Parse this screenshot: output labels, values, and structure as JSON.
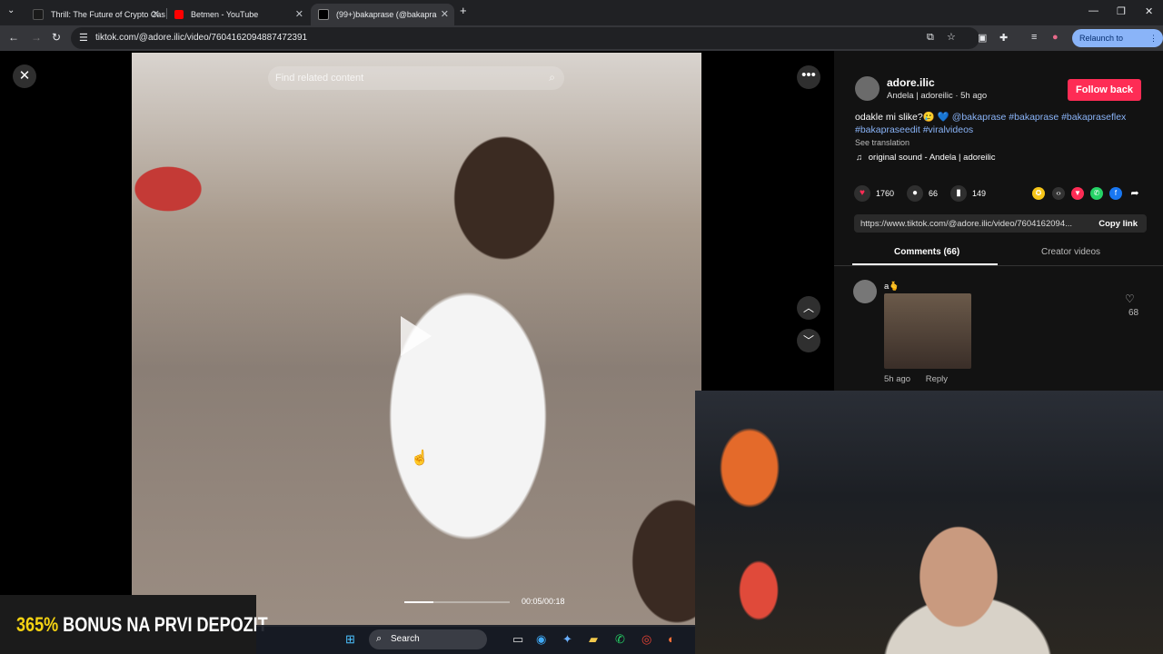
{
  "browser": {
    "tabs": [
      {
        "title": "Thrill: The Future of Crypto Casi",
        "favicon_color": "#1a1a1a"
      },
      {
        "title": "Betmen - YouTube",
        "favicon_color": "#ff0000"
      },
      {
        "title": "(99+)bakaprase (@bakapra",
        "favicon_color": "#000000"
      }
    ],
    "new_tab": "+",
    "url": "tiktok.com/@adore.ilic/video/7604162094887472391",
    "relaunch_label": "Relaunch to update"
  },
  "video": {
    "search_placeholder": "Find related content",
    "timecode": "00:05/00:18",
    "progress": 0.28
  },
  "post": {
    "username": "adore.ilic",
    "subline": "Andela | adoreilic · 5h ago",
    "follow_label": "Follow back",
    "desc_text": "odakle mi slike?🥲 💙 ",
    "desc_tags": "@bakaprase #bakaprase #bakapraseflex #bakapraseedit #viralvideos",
    "see_translation": "See translation",
    "sound": "original sound - Andela | adoreilic",
    "likes": "1760",
    "comments": "66",
    "saves": "149",
    "link": "https://www.tiktok.com/@adore.ilic/video/7604162094...",
    "copy_link": "Copy link",
    "tab_comments": "Comments (66)",
    "tab_creator": "Creator videos"
  },
  "comment": {
    "name": "a🫰",
    "time": "5h ago",
    "reply": "Reply",
    "likes": "68"
  },
  "ad": {
    "percent": "365%",
    "text": " BONUS NA PRVI DEPOZIT"
  },
  "taskbar": {
    "search_label": "Search"
  },
  "colors": {
    "accent": "#fe2c55",
    "link": "#8ab4f8"
  }
}
